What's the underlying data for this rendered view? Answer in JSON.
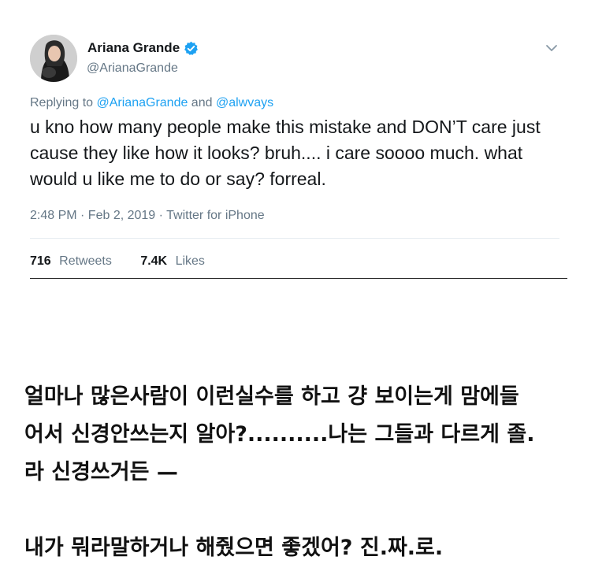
{
  "tweet": {
    "display_name": "Ariana Grande",
    "handle": "@ArianaGrande",
    "replying_prefix": "Replying to ",
    "replying_to_1": "@ArianaGrande",
    "replying_and": " and ",
    "replying_to_2": "@alwvays",
    "text": "u kno how many people make this mistake and DON’T care just cause they like how it looks? bruh.... i care soooo much. what would u like me to do or say? forreal.",
    "timestamp": "2:48 PM · Feb 2, 2019 · Twitter for iPhone",
    "retweets_count": "716",
    "retweets_label": "Retweets",
    "likes_count": "7.4K",
    "likes_label": "Likes",
    "verified_color": "#1da1f2"
  },
  "translation": {
    "line1": "얼마나 많은사람이 이런실수를 하고 걍 보이는게 맘에들",
    "line2": "어서 신경안쓰는지 알아?..........나는 그들과 다르게 졸.",
    "line3": "라 신경쓰거든 —",
    "line4": "내가 뭐라말하거나 해줬으면 좋겠어? 진.짜.로."
  }
}
